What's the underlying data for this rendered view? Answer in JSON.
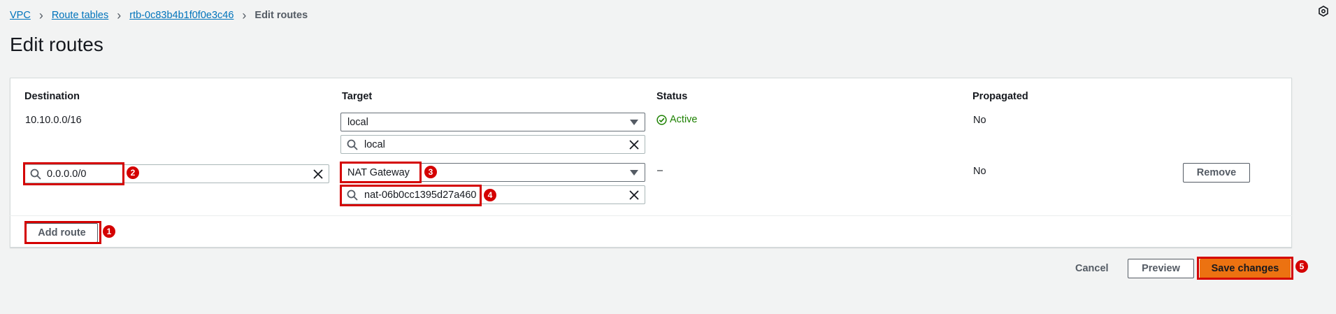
{
  "breadcrumb": {
    "items": [
      "VPC",
      "Route tables",
      "rtb-0c83b4b1f0f0e3c46"
    ],
    "current": "Edit routes",
    "separator": ">"
  },
  "page": {
    "title": "Edit routes"
  },
  "table": {
    "headers": {
      "destination": "Destination",
      "target": "Target",
      "status": "Status",
      "propagated": "Propagated"
    },
    "rows": [
      {
        "destination": "10.10.0.0/16",
        "target_select": "local",
        "target_search": "local",
        "status": "Active",
        "propagated": "No"
      },
      {
        "destination_input": "0.0.0.0/0",
        "target_select": "NAT Gateway",
        "target_search": "nat-06b0cc1395d27a460",
        "status": "–",
        "propagated": "No",
        "remove_label": "Remove"
      }
    ],
    "add_route_label": "Add route"
  },
  "actions": {
    "cancel": "Cancel",
    "preview": "Preview",
    "save": "Save changes"
  },
  "annotations": [
    "1",
    "2",
    "3",
    "4",
    "5"
  ],
  "colors": {
    "link": "#0073bb",
    "primary_button": "#ec7211",
    "status_active": "#1d8102",
    "highlight": "#d40000",
    "background": "#f2f3f3"
  },
  "icons": [
    "chevron-right-icon",
    "search-icon",
    "clear-icon",
    "caret-down-icon",
    "check-circle-icon",
    "settings-hexagon-icon"
  ]
}
